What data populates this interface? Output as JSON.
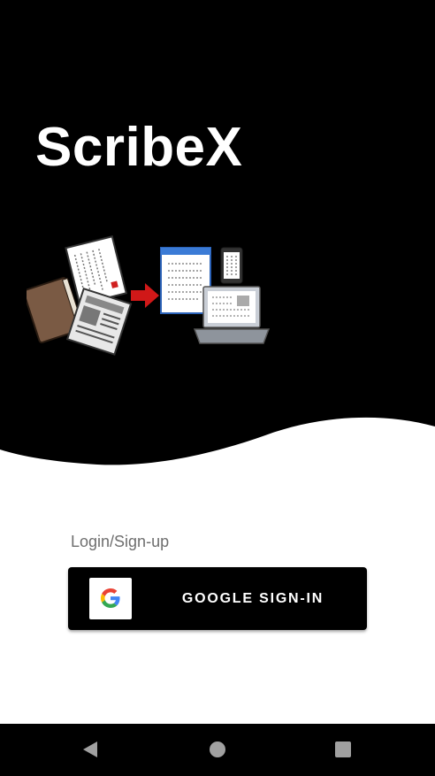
{
  "app": {
    "title": "ScribeX",
    "illustration_icon": "documents-to-digital-devices-illustration"
  },
  "login": {
    "label": "Login/Sign-up",
    "google_button_label": "GOOGLE SIGN-IN",
    "google_icon": "google-g-icon"
  },
  "nav_bar": {
    "back_icon": "back-triangle-icon",
    "home_icon": "home-circle-icon",
    "recents_icon": "recents-square-icon"
  },
  "colors": {
    "hero_background": "#000000",
    "page_background": "#ffffff",
    "title_text": "#ffffff",
    "label_text": "#6e6e6e",
    "button_background": "#000000",
    "button_text": "#ffffff",
    "nav_icons": "#a0a0a0",
    "arrow_red": "#d01818"
  }
}
